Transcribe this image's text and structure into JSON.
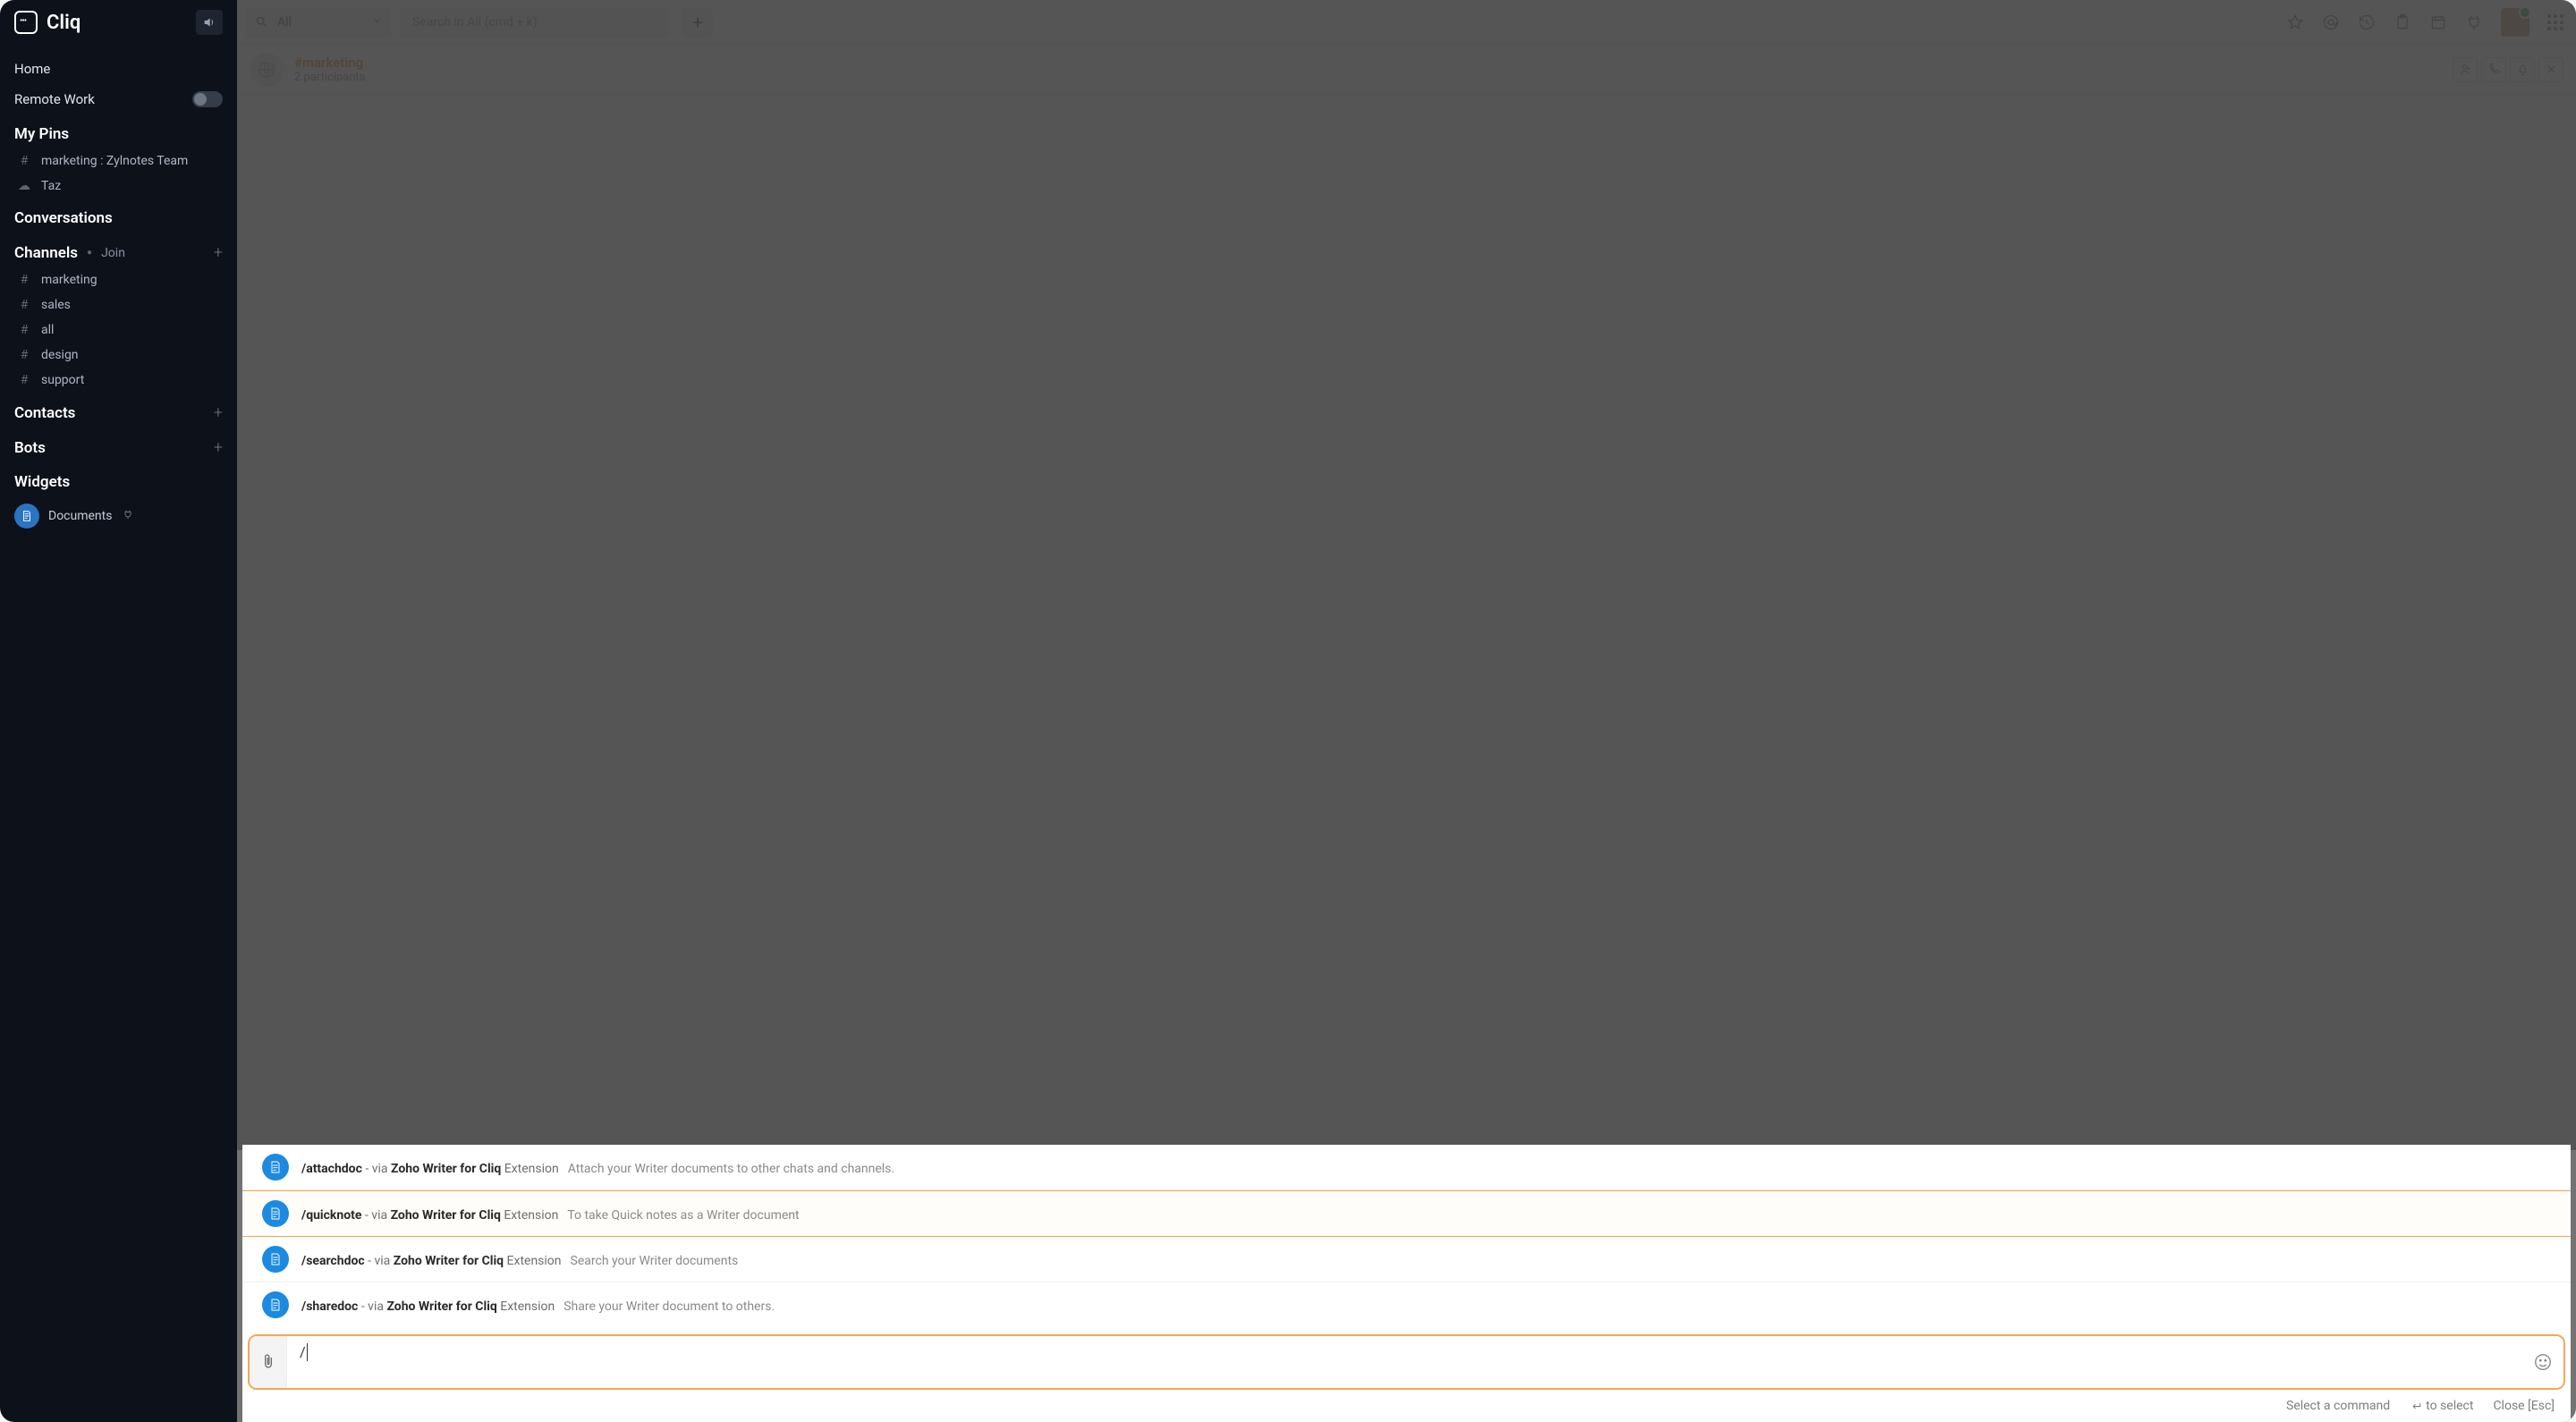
{
  "app": {
    "name": "Cliq"
  },
  "topbar": {
    "scope_label": "All",
    "search_placeholder": "Search in All (cmd + k)"
  },
  "sidebar": {
    "home": "Home",
    "remote_work": "Remote Work",
    "pins_title": "My Pins",
    "pins": [
      {
        "icon": "hash",
        "label": "marketing : Zylnotes Team"
      },
      {
        "icon": "cloud",
        "label": "Taz"
      }
    ],
    "conversations_title": "Conversations",
    "channels_title": "Channels",
    "channels_join": "Join",
    "channels": [
      {
        "label": "marketing"
      },
      {
        "label": "sales"
      },
      {
        "label": "all"
      },
      {
        "label": "design"
      },
      {
        "label": "support"
      }
    ],
    "contacts_title": "Contacts",
    "bots_title": "Bots",
    "widgets_title": "Widgets",
    "widget_doc": "Documents"
  },
  "channel": {
    "name": "#marketing",
    "subtitle": "2 participants"
  },
  "suggestions": [
    {
      "cmd": "/attachdoc",
      "via": " - via ",
      "ext": "Zoho Writer for Cliq",
      "ext_word": " Extension",
      "desc": "Attach your Writer documents to other chats and channels."
    },
    {
      "cmd": "/quicknote",
      "via": " - via ",
      "ext": "Zoho Writer for Cliq",
      "ext_word": " Extension",
      "desc": "To take Quick notes as a Writer document"
    },
    {
      "cmd": "/searchdoc",
      "via": " - via ",
      "ext": "Zoho Writer for Cliq",
      "ext_word": " Extension",
      "desc": "Search your Writer documents"
    },
    {
      "cmd": "/sharedoc",
      "via": " - via ",
      "ext": "Zoho Writer for Cliq",
      "ext_word": " Extension",
      "desc": "Share your Writer document to others."
    }
  ],
  "composer": {
    "value": "/"
  },
  "hints": {
    "select_command": "Select a command",
    "to_select": "to select",
    "close": "Close [Esc]"
  }
}
